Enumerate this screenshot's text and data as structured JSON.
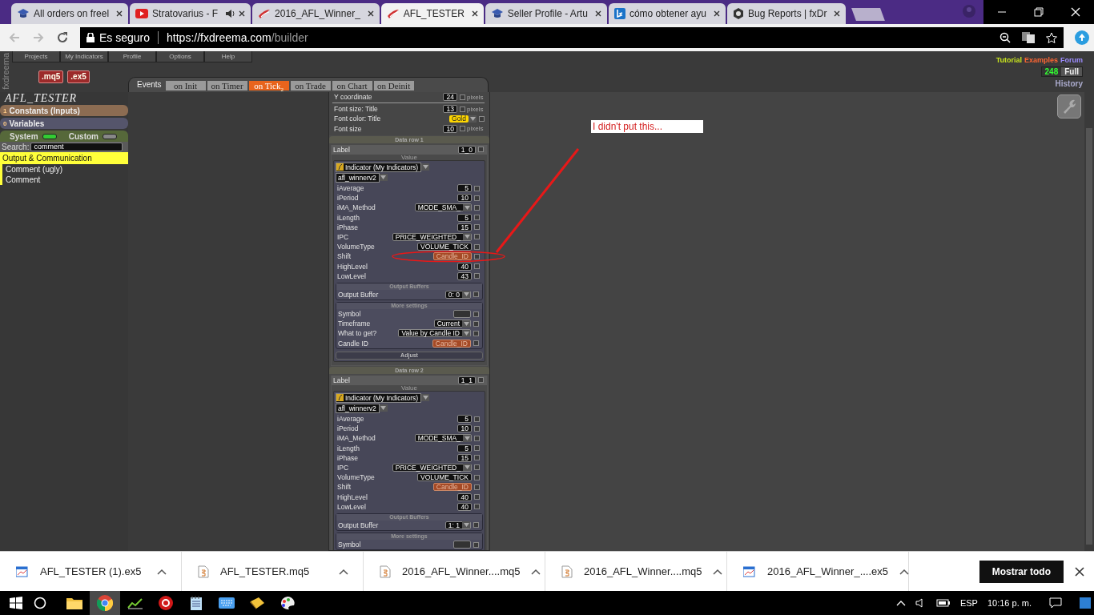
{
  "browser_tabs": [
    {
      "title": "All orders on freel",
      "kind": "cap",
      "audio": false,
      "selected": false
    },
    {
      "title": "Stratovarius - F",
      "kind": "video",
      "audio": true,
      "selected": false
    },
    {
      "title": "2016_AFL_Winner_",
      "kind": "swoosh",
      "audio": false,
      "selected": false
    },
    {
      "title": "AFL_TESTER",
      "kind": "swoosh",
      "audio": false,
      "selected": true
    },
    {
      "title": "Seller Profile - Artu",
      "kind": "cap",
      "audio": false,
      "selected": false
    },
    {
      "title": "cómo obtener ayu",
      "kind": "bing",
      "audio": false,
      "selected": false
    },
    {
      "title": "Bug Reports | fxDr",
      "kind": "hexagon",
      "audio": false,
      "selected": false
    }
  ],
  "address_bar": {
    "security": "Es seguro",
    "url_host": "https://fxdreema.com",
    "url_path": "/builder"
  },
  "app": {
    "brand": "fxdreema",
    "menu": [
      "Projects",
      "My Indicators",
      "Profile",
      "Options",
      "Help"
    ],
    "file_buttons": [
      ".mq5",
      ".ex5"
    ],
    "events": {
      "label": "Events",
      "tabs": [
        {
          "label": "on Init",
          "selected": false
        },
        {
          "label": "on Timer",
          "selected": false
        },
        {
          "label": "on Tick",
          "selected": true,
          "count": "2"
        },
        {
          "label": "on Trade",
          "selected": false
        },
        {
          "label": "on Chart",
          "selected": false
        },
        {
          "label": "on Deinit",
          "selected": false
        }
      ]
    },
    "links": [
      {
        "label": "Tutorial",
        "color": "#c8e41e"
      },
      {
        "label": "Examples",
        "color": "#ff6633"
      },
      {
        "label": "Forum",
        "color": "#9c8cff"
      }
    ],
    "counter": {
      "value": "248",
      "label": "Full"
    },
    "history": "History"
  },
  "sidebar": {
    "project": "AFL_TESTER",
    "sections": [
      {
        "count": "1",
        "label": "Constants (Inputs)",
        "color": "#8c6c52"
      },
      {
        "count": "0",
        "label": "Variables",
        "color": "#55556b"
      }
    ],
    "toggles": [
      {
        "label": "System",
        "on": true
      },
      {
        "label": "Custom",
        "on": false
      }
    ],
    "search": {
      "label": "Search:",
      "value": "comment"
    },
    "category": "Output & Communication",
    "items": [
      "Comment (ugly)",
      "Comment"
    ]
  },
  "panel": {
    "top_rows": [
      {
        "label": "Y coordinate",
        "value": "24",
        "kind": "number",
        "unit": "pixels",
        "checked": false
      },
      {
        "label": "Font size: Title",
        "value": "13",
        "kind": "number",
        "unit": "pixels",
        "checked": false
      },
      {
        "label": "Font color: Title",
        "value": "Gold",
        "kind": "color",
        "checked": false
      },
      {
        "label": "Font size",
        "value": "10",
        "kind": "number",
        "unit": "pixels",
        "checked": false
      }
    ],
    "data_rows": [
      {
        "heading": "Data row 1",
        "label_name": "Label",
        "label_value": "1_0",
        "label_checked": false,
        "value_heading": "Value",
        "source": "Indicator (My Indicators)",
        "indicator": "afl_winnerv2",
        "params": [
          {
            "name": "iAverage",
            "value": "5",
            "kind": "number",
            "checked": false
          },
          {
            "name": "iPeriod",
            "value": "10",
            "kind": "number",
            "checked": false
          },
          {
            "name": "iMA_Method",
            "value": "MODE_SMA_",
            "kind": "select",
            "checked": false
          },
          {
            "name": "iLength",
            "value": "5",
            "kind": "number",
            "checked": false
          },
          {
            "name": "iPhase",
            "value": "15",
            "kind": "number",
            "checked": false
          },
          {
            "name": "IPC",
            "value": "PRICE_WEIGHTED_",
            "kind": "select",
            "checked": false
          },
          {
            "name": "VolumeType",
            "value": "VOLUME_TICK",
            "kind": "text",
            "checked": false
          },
          {
            "name": "Shift",
            "value": "Candle_ID",
            "kind": "candle",
            "checked": false
          },
          {
            "name": "HighLevel",
            "value": "40",
            "kind": "number",
            "checked": false
          },
          {
            "name": "LowLevel",
            "value": "43",
            "kind": "number",
            "checked": false
          }
        ],
        "buffers_heading": "Output Buffers",
        "buffer_label": "Output Buffer",
        "buffer_value": "0: 0",
        "buffer_checked": false,
        "more_heading": "More settings",
        "more": [
          {
            "name": "Symbol",
            "kind": "blank",
            "checked": false
          },
          {
            "name": "Timeframe",
            "value": "Current",
            "kind": "select",
            "checked": false
          },
          {
            "name": "What to get?",
            "value": "Value by Candle ID",
            "kind": "select",
            "checked": false
          },
          {
            "name": "Candle ID",
            "value": "Candle_ID",
            "kind": "candle",
            "checked": false
          }
        ],
        "adjust": "Adjust"
      },
      {
        "heading": "Data row 2",
        "label_name": "Label",
        "label_value": "1_1",
        "label_checked": false,
        "value_heading": "Value",
        "source": "Indicator (My Indicators)",
        "indicator": "afl_winnerv2",
        "params": [
          {
            "name": "iAverage",
            "value": "5",
            "kind": "number",
            "checked": false
          },
          {
            "name": "iPeriod",
            "value": "10",
            "kind": "number",
            "checked": false
          },
          {
            "name": "iMA_Method",
            "value": "MODE_SMA_",
            "kind": "select",
            "checked": false
          },
          {
            "name": "iLength",
            "value": "5",
            "kind": "number",
            "checked": false
          },
          {
            "name": "iPhase",
            "value": "15",
            "kind": "number",
            "checked": false
          },
          {
            "name": "IPC",
            "value": "PRICE_WEIGHTED_",
            "kind": "select",
            "checked": false
          },
          {
            "name": "VolumeType",
            "value": "VOLUME_TICK",
            "kind": "text",
            "checked": false
          },
          {
            "name": "Shift",
            "value": "Candle_ID",
            "kind": "candle",
            "checked": false
          },
          {
            "name": "HighLevel",
            "value": "40",
            "kind": "number",
            "checked": false
          },
          {
            "name": "LowLevel",
            "value": "40",
            "kind": "number",
            "checked": false
          }
        ],
        "buffers_heading": "Output Buffers",
        "buffer_label": "Output Buffer",
        "buffer_value": "1: 1",
        "buffer_checked": false,
        "more_heading": "More settings",
        "more": [
          {
            "name": "Symbol",
            "kind": "blank",
            "checked": false
          }
        ]
      }
    ]
  },
  "canvas": {
    "note": "I didn't put this..."
  },
  "downloads": {
    "items": [
      {
        "name": "AFL_TESTER (1).ex5",
        "kind": "ex5"
      },
      {
        "name": "AFL_TESTER.mq5",
        "kind": "mq5"
      },
      {
        "name": "2016_AFL_Winner....mq5",
        "kind": "mq5"
      },
      {
        "name": "2016_AFL_Winner....mq5",
        "kind": "mq5"
      },
      {
        "name": "2016_AFL_Winner_....ex5",
        "kind": "ex5"
      }
    ],
    "show_all": "Mostrar todo"
  },
  "taskbar": {
    "apps": [
      {
        "kind": "folder",
        "selected": false
      },
      {
        "kind": "chrome",
        "selected": true
      },
      {
        "kind": "chart",
        "selected": false
      },
      {
        "kind": "q",
        "selected": false
      },
      {
        "kind": "notepad",
        "selected": false
      },
      {
        "kind": "keyboard",
        "selected": false
      },
      {
        "kind": "note",
        "selected": false
      },
      {
        "kind": "paint",
        "selected": false
      }
    ],
    "language": "ESP",
    "time": "10:16 p. m."
  }
}
